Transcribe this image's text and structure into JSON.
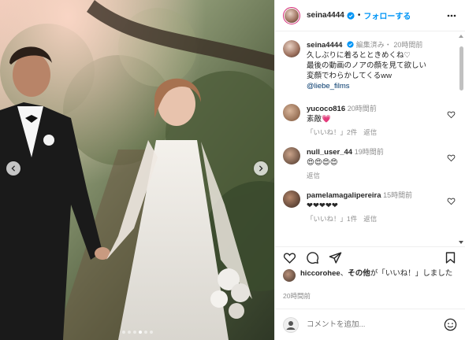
{
  "post": {
    "username": "seina4444",
    "follow_label": "フォローする",
    "separator": "•"
  },
  "caption": {
    "username": "seina4444",
    "edited": "編集済み・",
    "time": "20時間前",
    "lines": [
      "久しぶりに着るとときめくね♡",
      "最後の動画のノアの顔を見て欲しい",
      "変顔でわらかしてくるww"
    ],
    "mention": "@liebe_films"
  },
  "comments": [
    {
      "username": "yucoco816",
      "time": "20時間前",
      "text": "素敵💗",
      "likes": "「いいね！」2件",
      "reply": "返信"
    },
    {
      "username": "null_user_44",
      "time": "19時間前",
      "text": "😍😍😍😍",
      "likes": "",
      "reply": "返信"
    },
    {
      "username": "pamelamagalipereira",
      "time": "15時間前",
      "text": "❤❤❤❤❤",
      "likes": "「いいね！」1件",
      "reply": "返信"
    }
  ],
  "likes_line": {
    "user": "hiccorohee",
    "middle": "、",
    "others": "その他",
    "suffix": "が「いいね！」しました"
  },
  "timestamp": "20時間前",
  "add_comment": {
    "placeholder": "コメントを追加..."
  },
  "colors": {
    "accent": "#0095f6",
    "heart": "#ed4956",
    "ring": "#d62976"
  },
  "carousel": {
    "slide_count": 6,
    "active_index": 3
  }
}
